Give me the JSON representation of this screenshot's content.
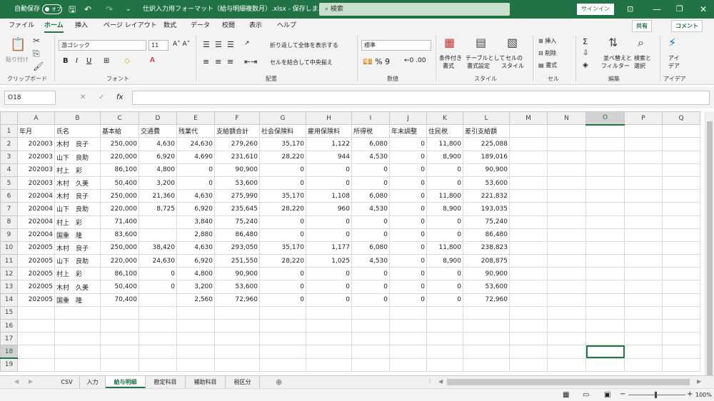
{
  "titlebar": {
    "autosave": "自動保存",
    "autosave_state": "オフ",
    "filename": "仕訳入力用フォーマット（給与明細複数月）.xlsx - 保存しま...",
    "search": "検索",
    "signin": "サインイン"
  },
  "tabs": [
    "ファイル",
    "ホーム",
    "挿入",
    "ページ レイアウト",
    "数式",
    "データ",
    "校閲",
    "表示",
    "ヘルプ"
  ],
  "share": "共有",
  "comment": "コメント",
  "ribbon": {
    "paste": "貼り付け",
    "clipboard": "クリップボード",
    "font_name": "游ゴシック",
    "font_size": "11",
    "font": "フォント",
    "wrap": "折り返して全体を表示する",
    "merge": "セルを結合して中央揃え",
    "alignment": "配置",
    "number_format": "標準",
    "number": "数値",
    "cond": "条件付き",
    "cond2": "書式",
    "table": "テーブルとして",
    "table2": "書式設定",
    "cellstyle": "セルの",
    "cellstyle2": "スタイル",
    "styles": "スタイル",
    "insert": "挿入",
    "delete": "削除",
    "format": "書式",
    "cells": "セル",
    "sort": "並べ替えと",
    "sort2": "フィルター",
    "find": "検索と",
    "find2": "選択",
    "editing": "編集",
    "ideas": "アイ",
    "ideas2": "デア",
    "ideas_grp": "アイデア"
  },
  "namebox": "O18",
  "columns": [
    "A",
    "B",
    "C",
    "D",
    "E",
    "F",
    "G",
    "H",
    "I",
    "J",
    "K",
    "L",
    "M",
    "N",
    "O",
    "P",
    "Q"
  ],
  "selected_col": "O",
  "selected_row": 18,
  "rows": [
    [
      "年月",
      "氏名",
      "基本給",
      "交通費",
      "残業代",
      "支給額合計",
      "社会保険料",
      "雇用保険料",
      "所得税",
      "年末調整",
      "住民税",
      "差引支給額"
    ],
    [
      "202003",
      "木村　良子",
      "250,000",
      "4,630",
      "24,630",
      "279,260",
      "35,170",
      "1,122",
      "6,080",
      "0",
      "11,800",
      "225,088"
    ],
    [
      "202003",
      "山下　良助",
      "220,000",
      "6,920",
      "4,690",
      "231,610",
      "28,220",
      "944",
      "4,530",
      "0",
      "8,900",
      "189,016"
    ],
    [
      "202003",
      "村上　彩",
      "86,100",
      "4,800",
      "0",
      "90,900",
      "0",
      "0",
      "0",
      "0",
      "0",
      "90,900"
    ],
    [
      "202003",
      "木村　久美",
      "50,400",
      "3,200",
      "0",
      "53,600",
      "0",
      "0",
      "0",
      "0",
      "0",
      "53,600"
    ],
    [
      "202004",
      "木村　良子",
      "250,000",
      "21,360",
      "4,630",
      "275,990",
      "35,170",
      "1,108",
      "6,080",
      "0",
      "11,800",
      "221,832"
    ],
    [
      "202004",
      "山下　良助",
      "220,000",
      "8,725",
      "6,920",
      "235,645",
      "28,220",
      "960",
      "4,530",
      "0",
      "8,900",
      "193,035"
    ],
    [
      "202004",
      "村上　彩",
      "71,400",
      "",
      "3,840",
      "75,240",
      "0",
      "0",
      "0",
      "0",
      "0",
      "75,240"
    ],
    [
      "202004",
      "国重　隆",
      "83,600",
      "",
      "2,880",
      "86,480",
      "0",
      "0",
      "0",
      "0",
      "0",
      "86,480"
    ],
    [
      "202005",
      "木村　良子",
      "250,000",
      "38,420",
      "4,630",
      "293,050",
      "35,170",
      "1,177",
      "6,080",
      "0",
      "11,800",
      "238,823"
    ],
    [
      "202005",
      "山下　良助",
      "220,000",
      "24,630",
      "6,920",
      "251,550",
      "28,220",
      "1,025",
      "4,530",
      "0",
      "8,900",
      "208,875"
    ],
    [
      "202005",
      "村上　彩",
      "86,100",
      "0",
      "4,800",
      "90,900",
      "0",
      "0",
      "0",
      "0",
      "0",
      "90,900"
    ],
    [
      "202005",
      "木村　久美",
      "50,400",
      "0",
      "3,200",
      "53,600",
      "0",
      "0",
      "0",
      "0",
      "0",
      "53,600"
    ],
    [
      "202005",
      "国重　隆",
      "70,400",
      "",
      "2,560",
      "72,960",
      "0",
      "0",
      "0",
      "0",
      "0",
      "72,960"
    ]
  ],
  "total_rows": 19,
  "sheets": [
    "CSV",
    "入力",
    "給与明細",
    "勘定科目",
    "補助科目",
    "税区分"
  ],
  "active_sheet": "給与明細",
  "zoom": "100%"
}
